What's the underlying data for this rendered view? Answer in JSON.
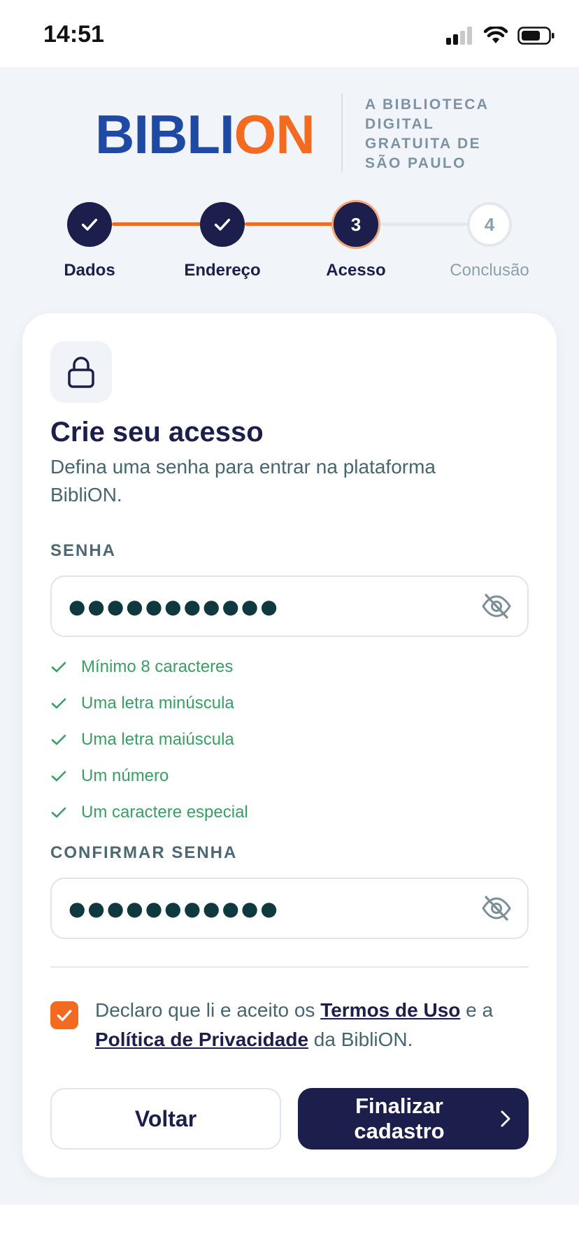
{
  "status_bar": {
    "time": "14:51"
  },
  "brand": {
    "logo_blue": "BIBLI",
    "logo_orange": "ON",
    "tagline": "A BIBLIOTECA DIGITAL GRATUITA DE SÃO PAULO"
  },
  "stepper": {
    "steps": [
      {
        "label": "Dados",
        "state": "done"
      },
      {
        "label": "Endereço",
        "state": "done"
      },
      {
        "label": "Acesso",
        "state": "active",
        "number": "3"
      },
      {
        "label": "Conclusão",
        "state": "todo",
        "number": "4"
      }
    ]
  },
  "card": {
    "title": "Crie seu acesso",
    "subtitle": "Defina uma senha para entrar na plataforma BibliON.",
    "password": {
      "label": "SENHA",
      "value": "●●●●●●●●●●●"
    },
    "rules": [
      "Mínimo 8 caracteres",
      "Uma letra minúscula",
      "Uma letra maiúscula",
      "Um número",
      "Um caractere especial"
    ],
    "confirm": {
      "label": "CONFIRMAR SENHA",
      "value": "●●●●●●●●●●●"
    },
    "terms": {
      "prefix": "Declaro que li e aceito os ",
      "terms_link": "Termos de Uso",
      "middle": " e a ",
      "privacy_link": "Política de Privacidade",
      "suffix": " da BibliON.",
      "checked": true
    },
    "back_label": "Voltar",
    "finish_label": "Finalizar cadastro"
  },
  "colors": {
    "navy": "#1c1f4c",
    "orange": "#f26b21",
    "blue": "#1e4aa4",
    "success": "#37a062"
  },
  "icons": [
    "lock-icon",
    "eye-off-icon",
    "check-icon",
    "chevron-right-icon",
    "signal-icon",
    "wifi-icon",
    "battery-icon"
  ]
}
